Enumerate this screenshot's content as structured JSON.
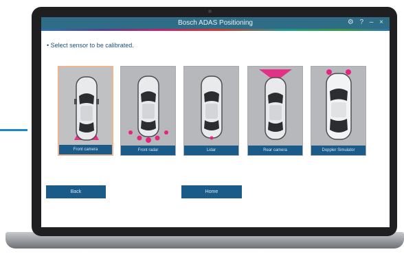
{
  "window": {
    "title": "Bosch ADAS Positioning",
    "controls": "⚙ ? – ×"
  },
  "instruction": "• Select sensor to be calibrated.",
  "sensors": [
    {
      "label": "Front camera",
      "selected": true
    },
    {
      "label": "Front radar",
      "selected": false
    },
    {
      "label": "Lidar",
      "selected": false
    },
    {
      "label": "Rear camera",
      "selected": false
    },
    {
      "label": "Doppler Simulator",
      "selected": false
    }
  ],
  "buttons": {
    "back": "Back",
    "home": "Home"
  },
  "colors": {
    "titlebar": "#2f6d86",
    "button": "#1b5b8a",
    "highlight": "#e8237f",
    "selected_border": "#f1b48f"
  }
}
